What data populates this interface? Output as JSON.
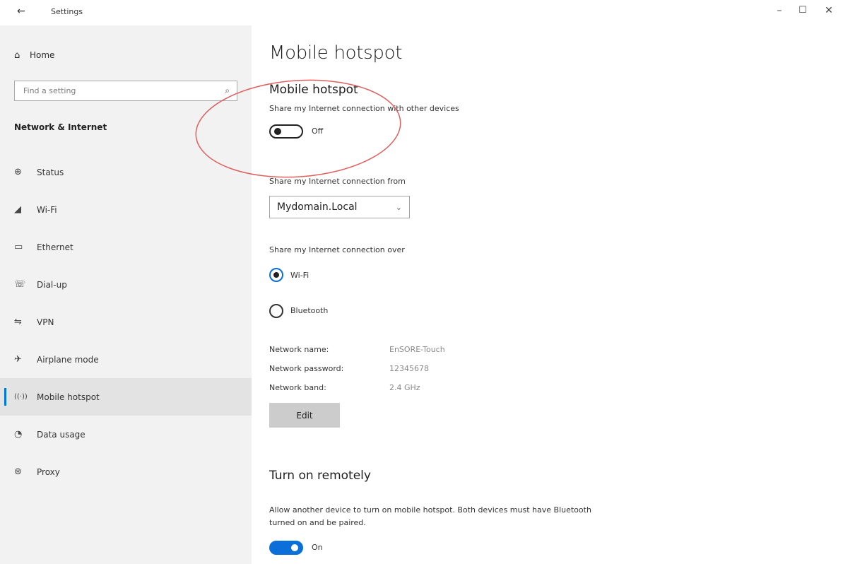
{
  "window": {
    "title": "Settings",
    "back_icon": "back-arrow-icon",
    "minimize": "–",
    "maximize": "☐",
    "close": "✕"
  },
  "sidebar": {
    "home_label": "Home",
    "search_placeholder": "Find a setting",
    "section_title": "Network & Internet",
    "items": [
      {
        "label": "Status",
        "icon": "globe-icon",
        "glyph": "⊕"
      },
      {
        "label": "Wi-Fi",
        "icon": "wifi-icon",
        "glyph": "◢"
      },
      {
        "label": "Ethernet",
        "icon": "ethernet-icon",
        "glyph": "▭"
      },
      {
        "label": "Dial-up",
        "icon": "phone-icon",
        "glyph": "☏"
      },
      {
        "label": "VPN",
        "icon": "vpn-icon",
        "glyph": "⇋"
      },
      {
        "label": "Airplane mode",
        "icon": "airplane-icon",
        "glyph": "✈"
      },
      {
        "label": "Mobile hotspot",
        "icon": "hotspot-icon",
        "glyph": "((·))",
        "active": true
      },
      {
        "label": "Data usage",
        "icon": "data-usage-icon",
        "glyph": "◔"
      },
      {
        "label": "Proxy",
        "icon": "proxy-icon",
        "glyph": "⊛"
      }
    ]
  },
  "main": {
    "page_title": "Mobile hotspot",
    "hotspot": {
      "heading": "Mobile hotspot",
      "description": "Share my Internet connection with other devices",
      "toggle_state": "Off"
    },
    "share_from": {
      "label": "Share my Internet connection from",
      "selected": "Mydomain.Local"
    },
    "share_over": {
      "label": "Share my Internet connection over",
      "options": [
        "Wi-Fi",
        "Bluetooth"
      ],
      "selected": "Wi-Fi"
    },
    "network_info": {
      "name_label": "Network name:",
      "name_value": "EnSORE-Touch",
      "password_label": "Network password:",
      "password_value": "12345678",
      "band_label": "Network band:",
      "band_value": "2.4 GHz"
    },
    "edit_label": "Edit",
    "remote": {
      "heading": "Turn on remotely",
      "description": "Allow another device to turn on mobile hotspot. Both devices must have Bluetooth turned on and be paired.",
      "toggle_state": "On"
    }
  },
  "colors": {
    "accent": "#0a6fd8",
    "sidebar_bg": "#f2f2f2",
    "active_bg": "#e3e3e3",
    "annotation": "#e06060"
  }
}
